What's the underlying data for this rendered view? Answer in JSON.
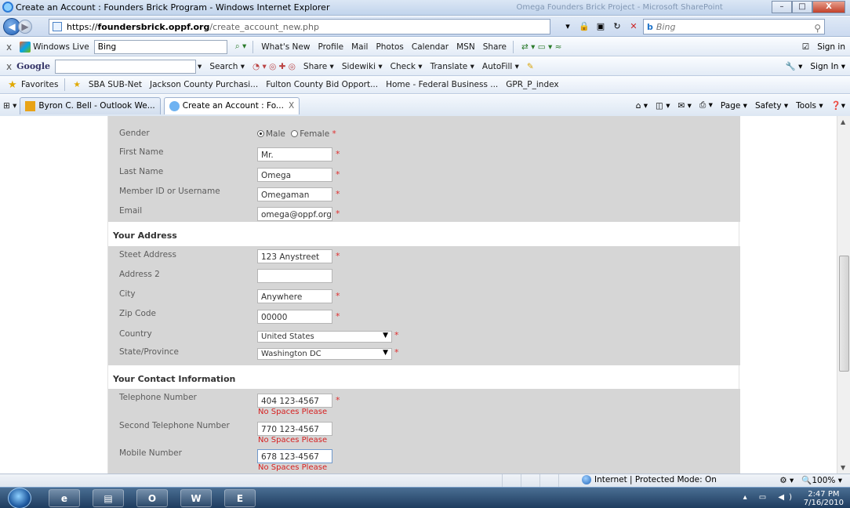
{
  "window": {
    "title": "Create an Account : Founders Brick Program - Windows Internet Explorer",
    "ghost_title": "Omega Founders Brick Project - Microsoft SharePoint",
    "min": "–",
    "max": "□",
    "close": "X"
  },
  "address_bar": {
    "url_scheme": "https://",
    "url_host": "foundersbrick.oppf.org",
    "url_path": "/create_account_new.php",
    "search_placeholder": "Bing",
    "search_provider": "b"
  },
  "toolbar_live": {
    "close": "x",
    "brand": "Windows Live",
    "search_value": "Bing",
    "items": [
      "What's New",
      "Profile",
      "Mail",
      "Photos",
      "Calendar",
      "MSN",
      "Share"
    ],
    "sign_in": "Sign in"
  },
  "toolbar_google": {
    "close": "x",
    "brand": "Google",
    "items": [
      "Search ▾",
      "Share ▾",
      "Sidewiki ▾",
      "Check ▾",
      "Translate ▾",
      "AutoFill ▾"
    ],
    "sign_in": "Sign In ▾"
  },
  "favorites": {
    "label": "Favorites",
    "items": [
      "SBA SUB-Net",
      "Jackson County Purchasi...",
      "Fulton County Bid Opport...",
      "Home - Federal Business ...",
      "GPR_P_index"
    ]
  },
  "tabs": {
    "items": [
      "Byron C. Bell - Outlook We...",
      "Create an Account : Fo..."
    ],
    "close": "X",
    "command_items": [
      "Page ▾",
      "Safety ▾",
      "Tools ▾"
    ]
  },
  "form": {
    "personal": {
      "gender_label": "Gender",
      "gender_male": "Male",
      "gender_female": "Female",
      "first_name_label": "First Name",
      "first_name_value": "Mr.",
      "last_name_label": "Last Name",
      "last_name_value": "Omega",
      "member_label": "Member ID or Username",
      "member_value": "Omegaman",
      "email_label": "Email",
      "email_value": "omega@oppf.org"
    },
    "address": {
      "heading": "Your Address",
      "street_label": "Steet Address",
      "street_value": "123 Anystreet",
      "address2_label": "Address 2",
      "address2_value": "",
      "city_label": "City",
      "city_value": "Anywhere",
      "zip_label": "Zip Code",
      "zip_value": "00000",
      "country_label": "Country",
      "country_value": "United States",
      "state_label": "State/Province",
      "state_value": "Washington DC"
    },
    "contact": {
      "heading": "Your Contact Information",
      "phone_label": "Telephone Number",
      "phone_value": "404 123-4567",
      "phone2_label": "Second Telephone Number",
      "phone2_value": "770 123-4567",
      "mobile_label": "Mobile Number",
      "mobile_value": "678 123-4567",
      "hint": "No Spaces Please"
    },
    "required_mark": "*"
  },
  "status": {
    "zone": "Internet | Protected Mode: On",
    "zoom": "100%"
  },
  "taskbar": {
    "time": "2:47 PM",
    "date": "7/16/2010"
  },
  "colors": {
    "section_bg": "#d6d6d6",
    "required": "#e03030",
    "hint": "#d62020"
  }
}
